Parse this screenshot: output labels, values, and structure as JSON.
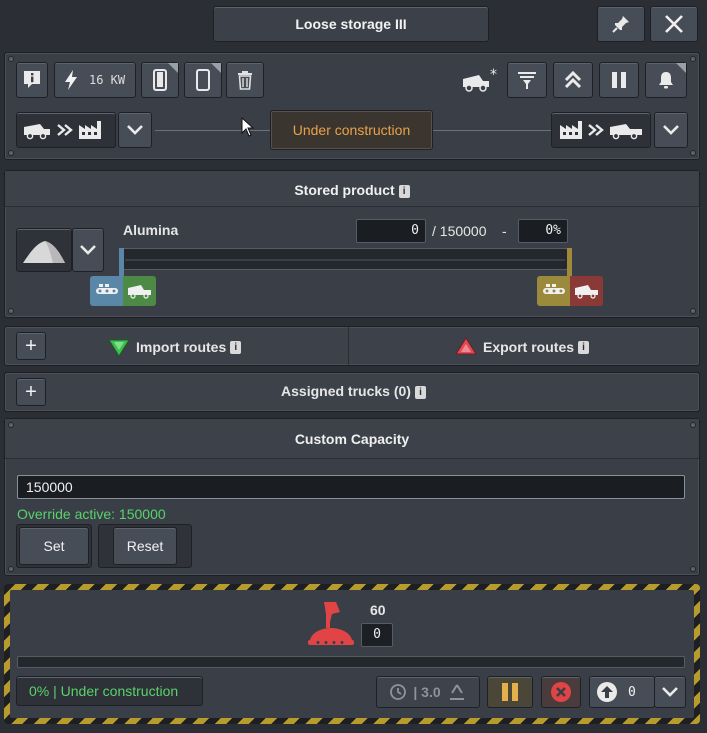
{
  "window": {
    "title": "Loose storage III"
  },
  "toolbar": {
    "power_label": "16 KW"
  },
  "routing": {
    "status": "Under construction"
  },
  "stored_product": {
    "title": "Stored product",
    "product_name": "Alumina",
    "amount": "0",
    "capacity": "/ 150000",
    "separator": "-",
    "percent": "0%",
    "fill_fraction": 0
  },
  "routes": {
    "import_label": "Import routes",
    "export_label": "Export routes"
  },
  "trucks": {
    "label": "Assigned trucks (0)"
  },
  "custom_capacity": {
    "title": "Custom Capacity",
    "input_value": "150000",
    "override_text": "Override active: 150000",
    "set_label": "Set",
    "reset_label": "Reset"
  },
  "construction": {
    "workers": "60",
    "workers_input": "0",
    "progress_fraction": 0,
    "status_text": "0% | Under construction",
    "speed_text": "| 3.0",
    "priority_value": "0"
  },
  "colors": {
    "accent_orange": "#e8a24a",
    "status_green": "#58d36a",
    "danger_red": "#e04444",
    "import_green": "#3fbf4f",
    "export_red": "#e04a55",
    "pause_yellow": "#e5b04a"
  }
}
